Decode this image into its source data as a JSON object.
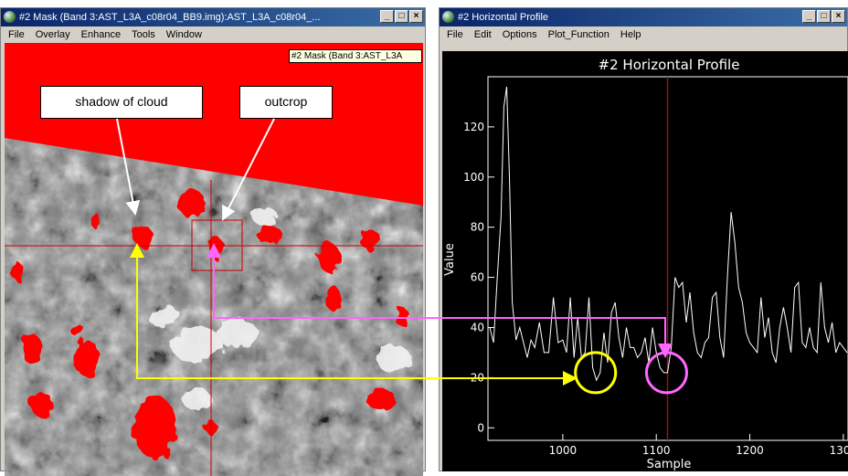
{
  "left_window": {
    "title": "#2 Mask (Band 3:AST_L3A_c08r04_BB9.img):AST_L3A_c08r04_...",
    "menu": [
      "File",
      "Overlay",
      "Enhance",
      "Tools",
      "Window"
    ],
    "tooltip": "#2 Mask (Band 3:AST_L3A"
  },
  "right_window": {
    "title": "#2 Horizontal Profile",
    "menu": [
      "File",
      "Edit",
      "Options",
      "Plot_Function",
      "Help"
    ]
  },
  "annotations": {
    "shadow_label": "shadow of cloud",
    "outcrop_label": "outcrop"
  },
  "colors": {
    "title_bar": "#0a246a",
    "mask_red": "#ff0000",
    "profile_line": "#ffffff",
    "cursor_line": "#8b1a1a",
    "arrow_yellow": "#ffff00",
    "arrow_pink": "#ff66ff",
    "plot_background": "#000000"
  },
  "chart_data": {
    "type": "line",
    "title": "#2 Horizontal Profile",
    "xlabel": "Sample",
    "ylabel": "Value",
    "xlim": [
      920,
      1305
    ],
    "ylim": [
      -5,
      140
    ],
    "xticks": [
      1000,
      1100,
      1200,
      1300
    ],
    "yticks": [
      0,
      20,
      40,
      60,
      80,
      100,
      120
    ],
    "cursor_x": 1112,
    "highlight_circles": [
      {
        "x": 1035,
        "y": 22,
        "color": "#ffff00"
      },
      {
        "x": 1111,
        "y": 22,
        "color": "#ff66ff"
      }
    ],
    "x": [
      922,
      926,
      930,
      934,
      937,
      940,
      943,
      946,
      950,
      954,
      958,
      962,
      966,
      970,
      975,
      980,
      985,
      990,
      995,
      1000,
      1004,
      1008,
      1012,
      1016,
      1020,
      1024,
      1028,
      1032,
      1036,
      1040,
      1044,
      1048,
      1052,
      1056,
      1060,
      1064,
      1068,
      1072,
      1076,
      1080,
      1084,
      1088,
      1092,
      1096,
      1100,
      1104,
      1108,
      1112,
      1116,
      1120,
      1124,
      1128,
      1132,
      1136,
      1140,
      1144,
      1148,
      1152,
      1156,
      1160,
      1164,
      1168,
      1172,
      1176,
      1180,
      1184,
      1188,
      1192,
      1196,
      1200,
      1204,
      1208,
      1212,
      1216,
      1220,
      1224,
      1228,
      1232,
      1236,
      1240,
      1244,
      1248,
      1252,
      1256,
      1260,
      1264,
      1268,
      1272,
      1276,
      1280,
      1284,
      1288,
      1292,
      1296,
      1300,
      1304
    ],
    "values": [
      40,
      34,
      60,
      84,
      128,
      136,
      100,
      50,
      35,
      40,
      34,
      28,
      35,
      32,
      42,
      30,
      30,
      52,
      34,
      35,
      30,
      52,
      28,
      44,
      28,
      30,
      52,
      24,
      19,
      22,
      38,
      26,
      46,
      50,
      36,
      28,
      40,
      32,
      32,
      28,
      30,
      36,
      26,
      40,
      30,
      24,
      22,
      22,
      32,
      60,
      56,
      58,
      42,
      54,
      38,
      30,
      28,
      34,
      36,
      52,
      54,
      36,
      28,
      60,
      86,
      74,
      56,
      50,
      38,
      34,
      32,
      30,
      52,
      36,
      44,
      30,
      26,
      40,
      48,
      40,
      30,
      56,
      58,
      34,
      32,
      40,
      32,
      30,
      58,
      40,
      34,
      42,
      30,
      34,
      32,
      30
    ]
  }
}
